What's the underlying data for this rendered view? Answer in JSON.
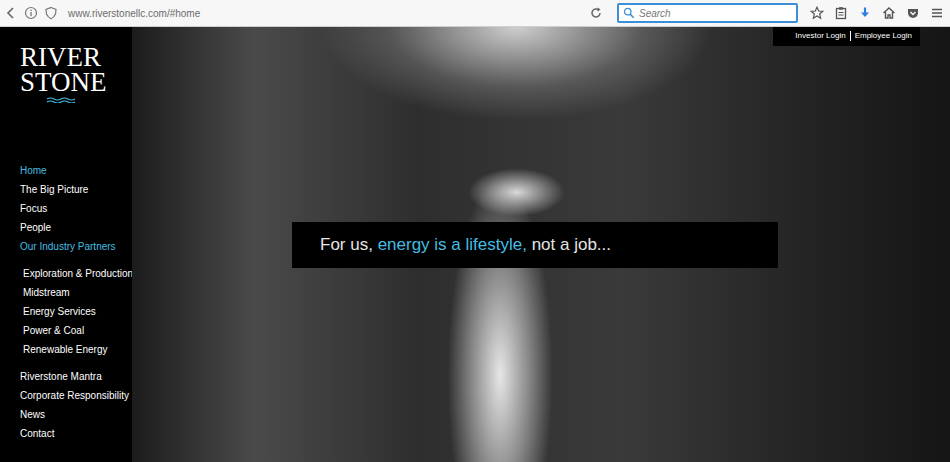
{
  "browser": {
    "url": "www.riverstonellc.com/#home",
    "search": {
      "placeholder": "Search"
    }
  },
  "logo": {
    "line1": "RIVER",
    "line2": "STONE"
  },
  "nav": [
    {
      "label": "Home",
      "kind": "main",
      "selected": true,
      "expanded": false
    },
    {
      "label": "The Big Picture",
      "kind": "main",
      "selected": false,
      "expanded": false
    },
    {
      "label": "Focus",
      "kind": "main",
      "selected": false,
      "expanded": false
    },
    {
      "label": "People",
      "kind": "main",
      "selected": false,
      "expanded": false
    },
    {
      "label": "Our Industry Partners",
      "kind": "main",
      "selected": false,
      "expanded": true
    },
    {
      "label": "Exploration & Production",
      "kind": "sub",
      "selected": false,
      "expanded": false
    },
    {
      "label": "Midstream",
      "kind": "sub",
      "selected": false,
      "expanded": false
    },
    {
      "label": "Energy Services",
      "kind": "sub",
      "selected": false,
      "expanded": false
    },
    {
      "label": "Power & Coal",
      "kind": "sub",
      "selected": false,
      "expanded": false
    },
    {
      "label": "Renewable Energy",
      "kind": "sub",
      "selected": false,
      "expanded": false
    },
    {
      "label": "Riverstone Mantra",
      "kind": "main",
      "selected": false,
      "expanded": false
    },
    {
      "label": "Corporate Responsibility",
      "kind": "main",
      "selected": false,
      "expanded": false
    },
    {
      "label": "News",
      "kind": "main",
      "selected": false,
      "expanded": false
    },
    {
      "label": "Contact",
      "kind": "main",
      "selected": false,
      "expanded": false
    }
  ],
  "header_links": [
    {
      "label": "Investor Login"
    },
    {
      "label": "Employee Login"
    }
  ],
  "banner": {
    "parts": [
      {
        "text": "For us, ",
        "highlight": false
      },
      {
        "text": "energy is a lifestyle,",
        "highlight": true
      },
      {
        "text": " not a job...",
        "highlight": false
      }
    ]
  }
}
